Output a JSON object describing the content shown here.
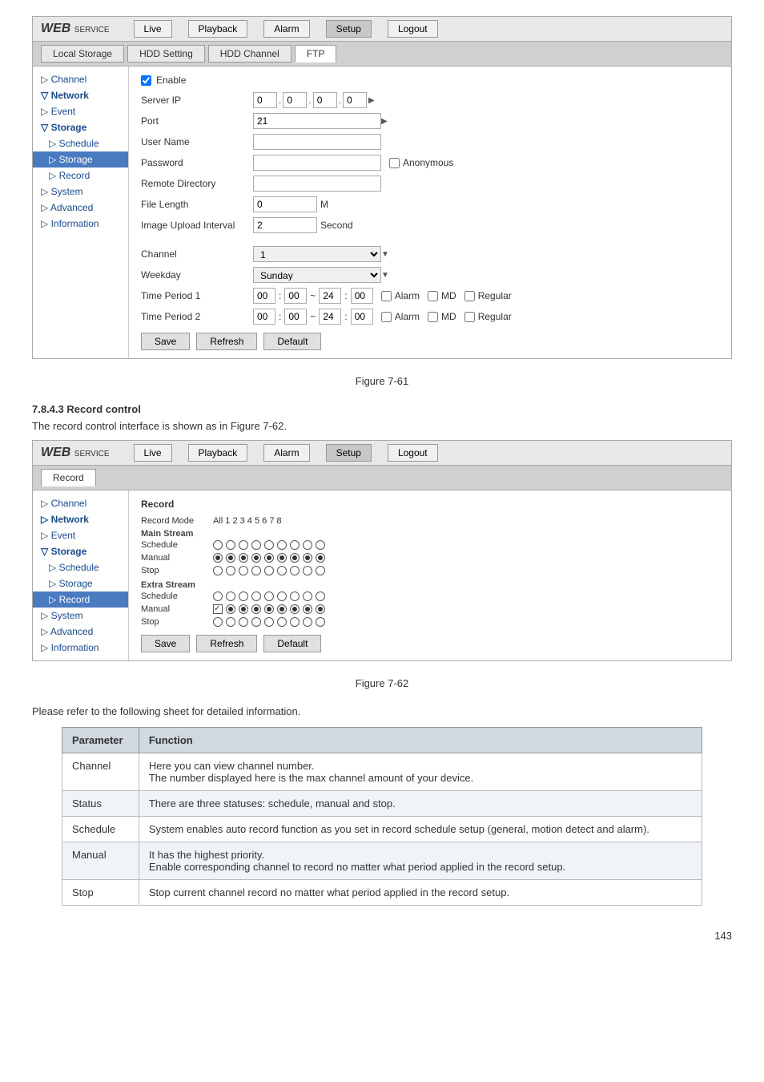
{
  "figure1": {
    "caption": "Figure 7-61",
    "web_logo": "WEB",
    "web_service": "SERVICE",
    "nav": {
      "live": "Live",
      "playback": "Playback",
      "alarm": "Alarm",
      "setup": "Setup",
      "logout": "Logout"
    },
    "tabs": {
      "local_storage": "Local Storage",
      "hdd_setting": "HDD Setting",
      "hdd_channel": "HDD Channel",
      "ftp": "FTP"
    },
    "sidebar": {
      "channel": "Channel",
      "network": "Network",
      "event": "Event",
      "storage": "Storage",
      "schedule": "Schedule",
      "storage2": "Storage",
      "record": "Record",
      "system": "System",
      "advanced": "Advanced",
      "information": "Information"
    },
    "form": {
      "enable_label": "Enable",
      "server_ip_label": "Server IP",
      "server_ip": "0 . 0 . 0 . 0",
      "port_label": "Port",
      "port_value": "21",
      "user_name_label": "User Name",
      "password_label": "Password",
      "anonymous_label": "Anonymous",
      "remote_dir_label": "Remote Directory",
      "file_length_label": "File Length",
      "file_length_value": "0",
      "file_length_unit": "M",
      "image_upload_label": "Image Upload Interval",
      "image_upload_value": "2",
      "image_upload_unit": "Second",
      "channel_label": "Channel",
      "channel_value": "1",
      "weekday_label": "Weekday",
      "weekday_value": "Sunday",
      "time_period1_label": "Time Period 1",
      "time_period1_start": "00 : 00",
      "time_period1_sep": "~",
      "time_period1_end": "24 : 00",
      "time_period1_alarm": "Alarm",
      "time_period1_md": "MD",
      "time_period1_regular": "Regular",
      "time_period2_label": "Time Period 2",
      "time_period2_start": "00 : 00",
      "time_period2_sep": "~",
      "time_period2_end": "24 : 00",
      "time_period2_alarm": "Alarm",
      "time_period2_md": "MD",
      "time_period2_regular": "Regular",
      "save_btn": "Save",
      "refresh_btn": "Refresh",
      "default_btn": "Default"
    }
  },
  "figure2": {
    "caption": "Figure 7-62",
    "web_logo": "WEB",
    "web_service": "SERVICE",
    "nav": {
      "live": "Live",
      "playback": "Playback",
      "alarm": "Alarm",
      "setup": "Setup",
      "logout": "Logout"
    },
    "tabs": {
      "record": "Record"
    },
    "sidebar": {
      "channel": "Channel",
      "network": "Network",
      "event": "Event",
      "storage": "Storage",
      "schedule": "Schedule",
      "storage2": "Storage",
      "record": "Record",
      "system": "System",
      "advanced": "Advanced",
      "information": "Information"
    },
    "record": {
      "title": "Record",
      "record_mode_label": "Record Mode",
      "all_channels": "All 1 2 3 4 5 6 7 8",
      "main_stream": "Main Stream",
      "schedule_label": "Schedule",
      "manual_label": "Manual",
      "stop_label": "Stop",
      "extra_stream": "Extra Stream",
      "save_btn": "Save",
      "refresh_btn": "Refresh",
      "default_btn": "Default"
    }
  },
  "section": {
    "heading": "7.8.4.3 Record control",
    "description": "The record control interface is shown as in Figure 7-62."
  },
  "table": {
    "headers": [
      "Parameter",
      "Function"
    ],
    "rows": [
      {
        "param": "Channel",
        "function": "Here you can view channel number.\nThe number displayed here is the max channel amount of your device."
      },
      {
        "param": "Status",
        "function": "There are three statuses: schedule, manual and stop."
      },
      {
        "param": "Schedule",
        "function": "System enables auto record function as you set in record schedule setup (general, motion detect and alarm)."
      },
      {
        "param": "Manual",
        "function": "It has the highest priority.\nEnable corresponding channel to record no matter what period applied in the record setup."
      },
      {
        "param": "Stop",
        "function": "Stop current channel record no matter what period applied in the record setup."
      }
    ]
  },
  "page_number": "143"
}
